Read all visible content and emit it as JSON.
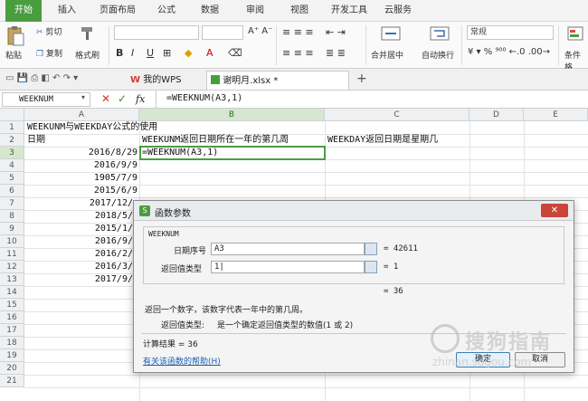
{
  "ribbon_tabs": [
    "开始",
    "插入",
    "页面布局",
    "公式",
    "数据",
    "审阅",
    "视图",
    "开发工具",
    "云服务"
  ],
  "ribbon": {
    "paste": "粘贴",
    "cut": "剪切",
    "copy": "复制",
    "format_painter": "格式刷",
    "merge_center": "合并居中",
    "auto_wrap": "自动换行",
    "number_format": "常规",
    "conditional_format": "条件格"
  },
  "doc_tabs": {
    "my_wps": "我的WPS",
    "file": "谢明月.xlsx *"
  },
  "formula_bar": {
    "name_box": "WEEKNUM",
    "fx": "fx",
    "formula": "=WEEKNUM(A3,1)"
  },
  "columns": [
    "A",
    "B",
    "C",
    "D",
    "E"
  ],
  "rows": [
    "1",
    "2",
    "3",
    "4",
    "5",
    "6",
    "7",
    "8",
    "9",
    "10",
    "11",
    "12",
    "13",
    "14",
    "15",
    "16",
    "17",
    "18",
    "19",
    "20",
    "21"
  ],
  "cells": {
    "A1": "WEEKUNM与WEEKDAY公式的使用",
    "A2": "日期",
    "B2": "WEEKUNM返回日期所在一年的第几周",
    "C2": "WEEKDAY返回日期是星期几",
    "A3": "2016/8/29",
    "B3": "=WEEKNUM(A3,1)",
    "A4": "2016/9/9",
    "A5": "1905/7/9",
    "A6": "2015/6/9",
    "A7": "2017/12/",
    "A8": "2018/5/",
    "A9": "2015/1/",
    "A10": "2016/9/",
    "A11": "2016/2/",
    "A12": "2016/3/",
    "A13": "2017/9/"
  },
  "dialog": {
    "title": "函数参数",
    "function_name": "WEEKNUM",
    "arg1_label": "日期序号",
    "arg1_value": "A3",
    "arg1_result": "= 42611",
    "arg2_label": "返回值类型",
    "arg2_value": "1|",
    "arg2_result": "= 1",
    "formula_result": "= 36",
    "description": "返回一个数字，该数字代表一年中的第几周。",
    "param_label": "返回值类型:",
    "param_desc": "是一个确定返回值类型的数值(1 或 2)",
    "calc_result": "计算结果 = 36",
    "help_link": "有关该函数的帮助(H)",
    "ok": "确定",
    "cancel": "取消"
  },
  "watermark": "搜狗指南",
  "watermark_url": "zhinan.sogou.com"
}
